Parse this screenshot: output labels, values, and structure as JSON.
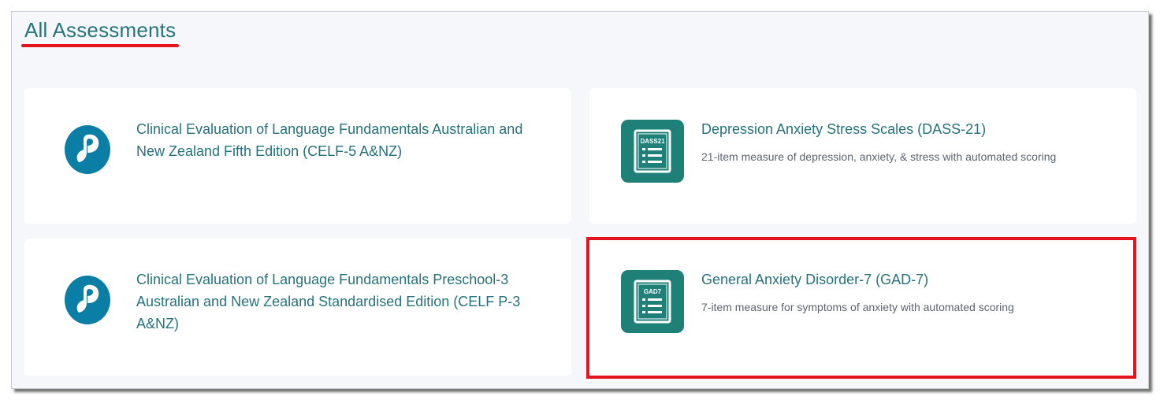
{
  "header": {
    "title": "All Assessments"
  },
  "colors": {
    "accent": "#26757c",
    "annotation_red": "#e3141b",
    "tile_green": "#1e8077",
    "pearson_blue": "#0a7ea4"
  },
  "cards": [
    {
      "title": "Clinical Evaluation of Language Fundamentals Australian and New Zealand Fifth Edition (CELF-5 A&NZ)",
      "description": "",
      "icon": "pearson-logo-icon"
    },
    {
      "title": "Depression Anxiety Stress Scales (DASS-21)",
      "description": "21-item measure of depression, anxiety, & stress with automated scoring",
      "icon": "dass21-icon",
      "icon_text": "DASS21"
    },
    {
      "title": "Clinical Evaluation of Language Fundamentals Preschool-3 Australian and New Zealand Standardised Edition (CELF P-3 A&NZ)",
      "description": "",
      "icon": "pearson-logo-icon"
    },
    {
      "title": "General Anxiety Disorder-7 (GAD-7)",
      "description": "7-item measure for symptoms of anxiety with automated scoring",
      "icon": "gad7-icon",
      "icon_text": "GAD7"
    }
  ]
}
